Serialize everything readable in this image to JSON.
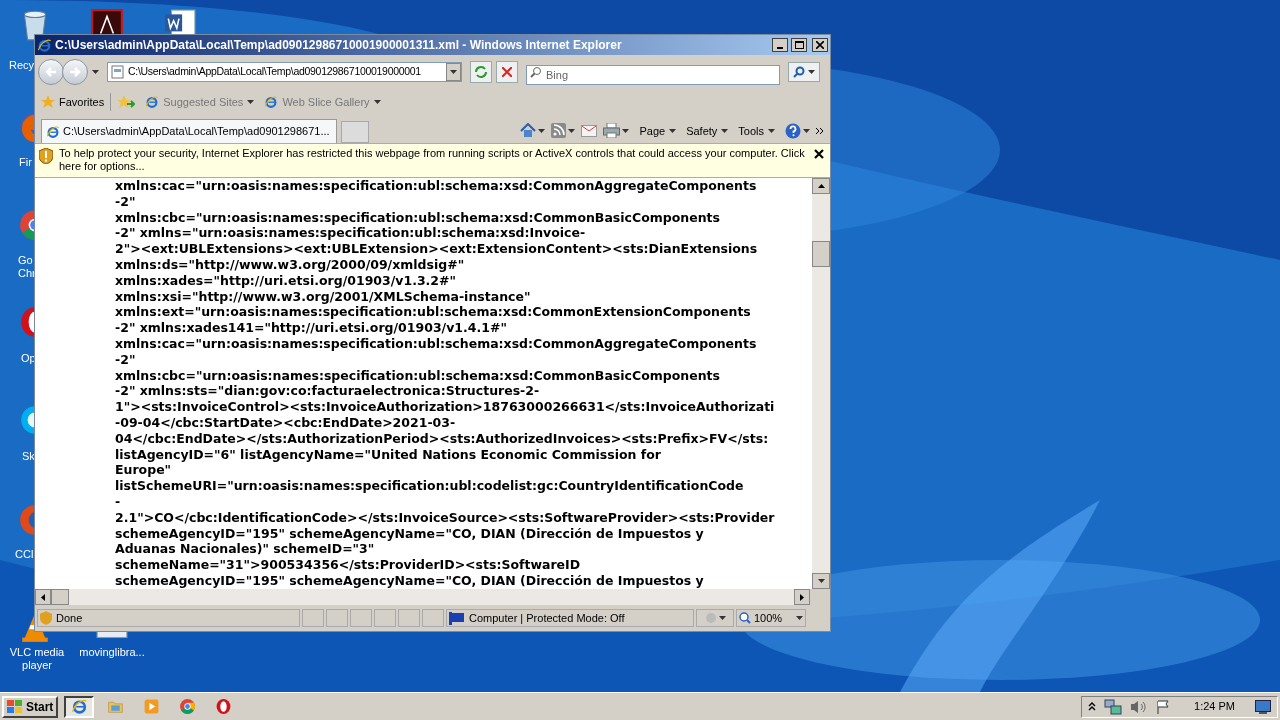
{
  "desktop": {
    "icons": [
      {
        "kind": "recycle",
        "lines": [
          "Recy"
        ]
      },
      {
        "kind": "pdf"
      },
      {
        "kind": "word"
      },
      {
        "kind": "firefox",
        "lines": [
          "Fir"
        ]
      },
      {
        "kind": "chrome",
        "lines": [
          "Go",
          "Chr"
        ]
      },
      {
        "kind": "opera",
        "lines": [
          "Op"
        ]
      },
      {
        "kind": "skype",
        "lines": [
          "Sk"
        ]
      },
      {
        "kind": "ccleaner",
        "lines": [
          "CCl"
        ]
      },
      {
        "kind": "vlc",
        "lines": [
          "VLC media",
          "player"
        ]
      },
      {
        "kind": "file",
        "lines": [
          "movinglibra..."
        ]
      }
    ]
  },
  "window": {
    "title": "C:\\Users\\admin\\AppData\\Local\\Temp\\ad09012986710001900001311.xml - Windows Internet Explorer",
    "address": "C:\\Users\\admin\\AppData\\Local\\Temp\\ad090129867100019000001",
    "search": {
      "placeholder": "Bing"
    },
    "favorites_bar": [
      {
        "kind": "favorites",
        "label": "Favorites"
      },
      {
        "kind": "site",
        "label": "Suggested Sites"
      },
      {
        "kind": "site",
        "label": "Web Slice Gallery"
      }
    ],
    "tabs": [
      {
        "label": "C:\\Users\\admin\\AppData\\Local\\Temp\\ad0901298671...",
        "selected": true
      }
    ],
    "command_bar": [
      "Page",
      "Safety",
      "Tools"
    ],
    "info_bar": "To help protect your security, Internet Explorer has restricted this webpage from running scripts or ActiveX controls that could access your computer. Click here for options...",
    "content_lines": [
      "xmlns:cac=\"urn:oasis:names:specification:ubl:schema:xsd:CommonAggregateComponents",
      "-2\"",
      "xmlns:cbc=\"urn:oasis:names:specification:ubl:schema:xsd:CommonBasicComponents",
      "-2\" xmlns=\"urn:oasis:names:specification:ubl:schema:xsd:Invoice-",
      "2\"><ext:UBLExtensions><ext:UBLExtension><ext:ExtensionContent><sts:DianExtensions",
      "xmlns:ds=\"http://www.w3.org/2000/09/xmldsig#\"",
      "xmlns:xades=\"http://uri.etsi.org/01903/v1.3.2#\"",
      "xmlns:xsi=\"http://www.w3.org/2001/XMLSchema-instance\"",
      "xmlns:ext=\"urn:oasis:names:specification:ubl:schema:xsd:CommonExtensionComponents",
      "-2\" xmlns:xades141=\"http://uri.etsi.org/01903/v1.4.1#\"",
      "xmlns:cac=\"urn:oasis:names:specification:ubl:schema:xsd:CommonAggregateComponents",
      "-2\"",
      "xmlns:cbc=\"urn:oasis:names:specification:ubl:schema:xsd:CommonBasicComponents",
      "-2\" xmlns:sts=\"dian:gov:co:facturaelectronica:Structures-2-",
      "1\"><sts:InvoiceControl><sts:InvoiceAuthorization>18763000266631</sts:InvoiceAuthorizati",
      "-09-04</cbc:StartDate><cbc:EndDate>2021-03-",
      "04</cbc:EndDate></sts:AuthorizationPeriod><sts:AuthorizedInvoices><sts:Prefix>FV</sts:",
      "listAgencyID=\"6\" listAgencyName=\"United Nations Economic Commission for",
      "Europe\"",
      "listSchemeURI=\"urn:oasis:names:specification:ubl:codelist:gc:CountryIdentificationCode",
      "-",
      "2.1\">CO</cbc:IdentificationCode></sts:InvoiceSource><sts:SoftwareProvider><sts:Provider",
      "schemeAgencyID=\"195\" schemeAgencyName=\"CO, DIAN (Dirección de Impuestos y",
      "Aduanas Nacionales)\" schemeID=\"3\"",
      "schemeName=\"31\">900534356</sts:ProviderID><sts:SoftwareID",
      "schemeAgencyID=\"195\" schemeAgencyName=\"CO, DIAN (Dirección de Impuestos y"
    ],
    "status_bar": {
      "text": "Done",
      "zone": "Computer | Protected Mode: Off",
      "zoom": "100%"
    }
  },
  "taskbar": {
    "start": "Start",
    "apps": [
      {
        "kind": "ie",
        "selected": true
      },
      {
        "kind": "folder",
        "selected": false
      },
      {
        "kind": "media",
        "selected": false
      },
      {
        "kind": "chrome",
        "selected": false
      },
      {
        "kind": "opera",
        "selected": false
      }
    ],
    "time": "1:24 PM"
  }
}
